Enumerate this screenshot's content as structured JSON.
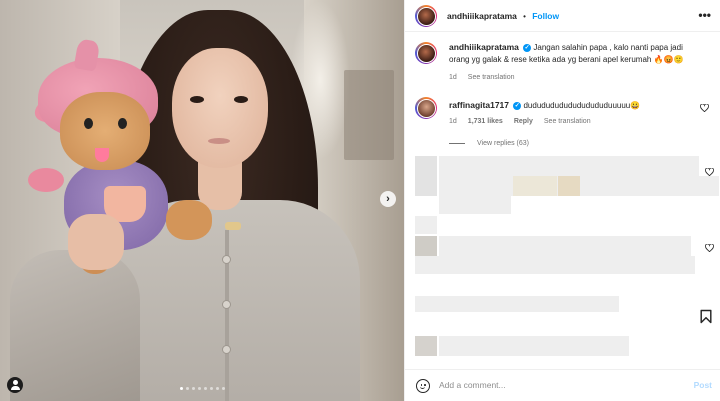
{
  "photo": {
    "carousel_dots": 8,
    "active_dot": 0,
    "next_glyph": "›"
  },
  "header": {
    "username": "andhiiikapratama",
    "separator": "•",
    "follow_label": "Follow",
    "more_glyph": "•••"
  },
  "caption": {
    "username": "andhiiikapratama",
    "text": "Jangan salahin papa , kalo nanti papa jadi orang yg galak & rese ketika ada yg berani apel kerumah 🔥😡🙂",
    "time": "1d",
    "translation_label": "See translation"
  },
  "comments": [
    {
      "username": "raffinagita1717",
      "text": "dudududududududududuuuuu😀",
      "time": "1d",
      "likes": "1,731 likes",
      "reply_label": "Reply",
      "translation_label": "See translation",
      "replies_label": "View replies (63)"
    }
  ],
  "composer": {
    "placeholder": "Add a comment...",
    "post_label": "Post"
  },
  "colors": {
    "accent": "#0095f6",
    "text": "#262626",
    "muted": "#737373",
    "post_disabled": "#b3dbff"
  },
  "icons": [
    "more-icon",
    "verified-icon",
    "heart-icon",
    "bookmark-icon",
    "emoji-icon",
    "chevron-right-icon",
    "tagged-user-icon"
  ]
}
